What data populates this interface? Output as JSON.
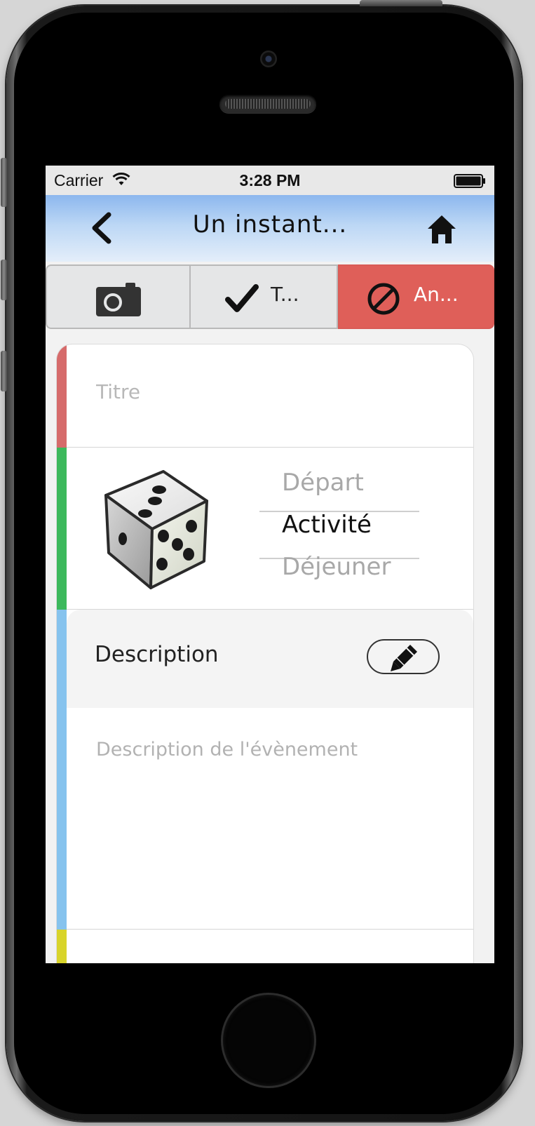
{
  "status_bar": {
    "carrier": "Carrier",
    "time": "3:28 PM",
    "icons": [
      "wifi-icon",
      "battery-icon"
    ]
  },
  "nav": {
    "title": "Un instant...",
    "back_icon": "chevron-left-icon",
    "home_icon": "home-icon",
    "background_top": "#8cb7ee"
  },
  "toolbar": {
    "photo_icon": "camera-icon",
    "done_label": "T...",
    "done_icon": "check-icon",
    "cancel_label": "An...",
    "cancel_icon": "ban-icon",
    "cancel_color": "#df5f59"
  },
  "form": {
    "title_placeholder": "Titre",
    "title_value": "",
    "picker_items": [
      {
        "label": "Départ",
        "selected": false
      },
      {
        "label": "Activité",
        "selected": true
      },
      {
        "label": "Déjeuner",
        "selected": false
      }
    ],
    "category_icon": "dice-icon",
    "description_label": "Description",
    "edit_icon": "pencil-icon",
    "description_placeholder": "Description de l'évènement",
    "stripe_colors": [
      "#d66b6b",
      "#3cb95c",
      "#86c3ee",
      "#d8d42a"
    ]
  }
}
